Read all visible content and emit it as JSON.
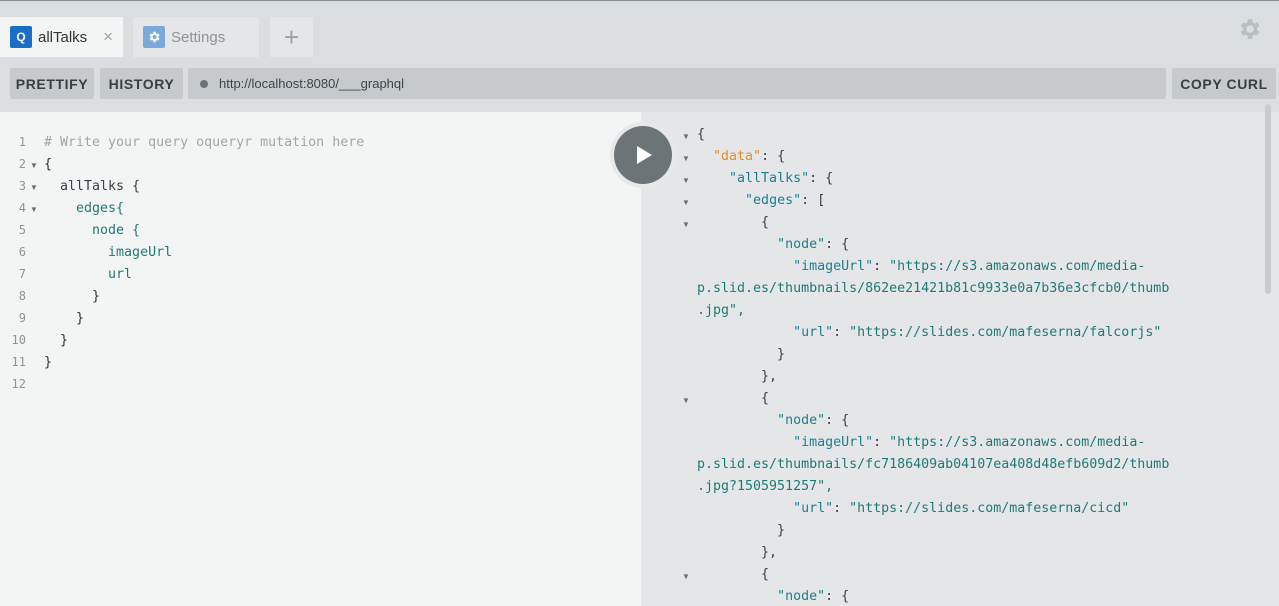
{
  "tabs": {
    "active": {
      "badge": "Q",
      "label": "allTalks",
      "close": "×"
    },
    "inactive": {
      "label": "Settings"
    },
    "add": "+"
  },
  "toolbar": {
    "prettify": "PRETTIFY",
    "history": "HISTORY",
    "url": "http://localhost:8080/___graphql",
    "copy_curl": "COPY CURL"
  },
  "editor": {
    "line_numbers": [
      "1",
      "2",
      "3",
      "4",
      "5",
      "6",
      "7",
      "8",
      "9",
      "10",
      "11",
      "12"
    ],
    "lines": [
      "# Write your query oqueryr mutation here",
      "{",
      "  allTalks {",
      "    edges{",
      "      node {",
      "        imageUrl",
      "        url",
      "      }",
      "    }",
      "  }",
      "}",
      ""
    ]
  },
  "result": {
    "lines": [
      "{",
      "  \"data\": {",
      "    \"allTalks\": {",
      "      \"edges\": [",
      "        {",
      "          \"node\": {",
      "            \"imageUrl\": \"https://s3.amazonaws.com/media-",
      "p.slid.es/thumbnails/862ee21421b81c9933e0a7b36e3cfcb0/thumb",
      ".jpg\",",
      "            \"url\": \"https://slides.com/mafeserna/falcorjs\"",
      "          }",
      "        },",
      "        {",
      "          \"node\": {",
      "            \"imageUrl\": \"https://s3.amazonaws.com/media-",
      "p.slid.es/thumbnails/fc7186409ab04107ea408d48efb609d2/thumb",
      ".jpg?1505951257\",",
      "            \"url\": \"https://slides.com/mafeserna/cicd\"",
      "          }",
      "        },",
      "        {",
      "          \"node\": {"
    ]
  },
  "colors": {
    "accent": "#1a6ec8",
    "key": "#1d7f92",
    "string": "#1f7a78",
    "data_key": "#e98c2c"
  }
}
